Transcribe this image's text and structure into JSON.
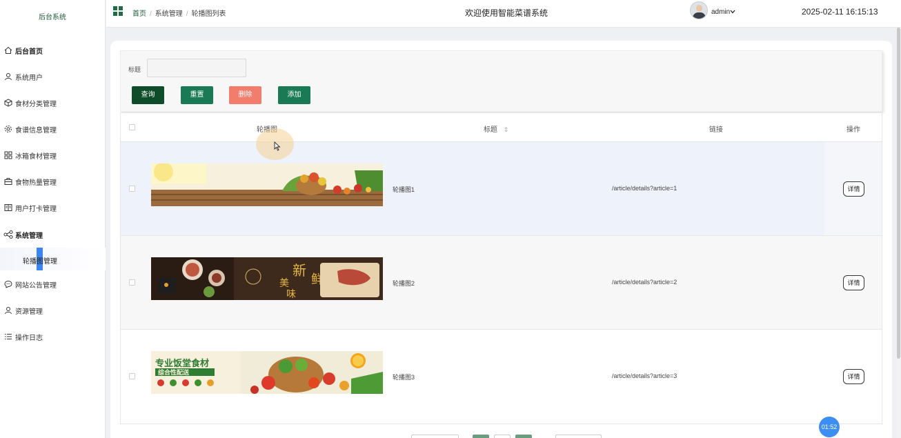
{
  "sidebar": {
    "title": "后台系统",
    "items": [
      {
        "label": "后台首页",
        "icon": "home-icon"
      },
      {
        "label": "系统用户",
        "icon": "user-icon"
      },
      {
        "label": "食材分类管理",
        "icon": "box-icon"
      },
      {
        "label": "食谱信息管理",
        "icon": "gear-icon"
      },
      {
        "label": "冰箱食材管理",
        "icon": "grid-icon"
      },
      {
        "label": "食物热量管理",
        "icon": "briefcase-icon"
      },
      {
        "label": "用户打卡管理",
        "icon": "book-icon"
      },
      {
        "label": "系统管理",
        "icon": "share-icon"
      },
      {
        "label": "网站公告管理",
        "icon": "chat-icon"
      },
      {
        "label": "资源管理",
        "icon": "user-icon"
      },
      {
        "label": "操作日志",
        "icon": "list-icon"
      }
    ],
    "sub_item": {
      "label": "轮播图管理"
    }
  },
  "header": {
    "breadcrumb": [
      "首页",
      "系统管理",
      "轮播图列表"
    ],
    "welcome": "欢迎使用智能菜谱系统",
    "user": "admin",
    "datetime": "2025-02-11 16:15:13"
  },
  "search": {
    "label": "标题",
    "placeholder": "",
    "buttons": {
      "query": "查询",
      "reset": "重置",
      "delete": "删除",
      "add": "添加"
    }
  },
  "table": {
    "headers": {
      "image": "轮播图",
      "title": "标题",
      "link": "链接",
      "action": "操作"
    },
    "rows": [
      {
        "title": "轮播图1",
        "link": "/article/details?article=1",
        "action": "详情"
      },
      {
        "title": "轮播图2",
        "link": "/article/details?article=2",
        "action": "详情"
      },
      {
        "title": "轮播图3",
        "link": "/article/details?article=3",
        "action": "详情"
      }
    ],
    "banner3_text_1": "专业饭堂食材",
    "banner3_text_2": "综合性配送",
    "banner2_text": "新鲜美味"
  },
  "timer": "01:52",
  "colors": {
    "primary": "#1a7a55",
    "dark_green": "#0f4d2a",
    "danger": "#f37d6d",
    "accent_blue": "#3a85f0"
  }
}
